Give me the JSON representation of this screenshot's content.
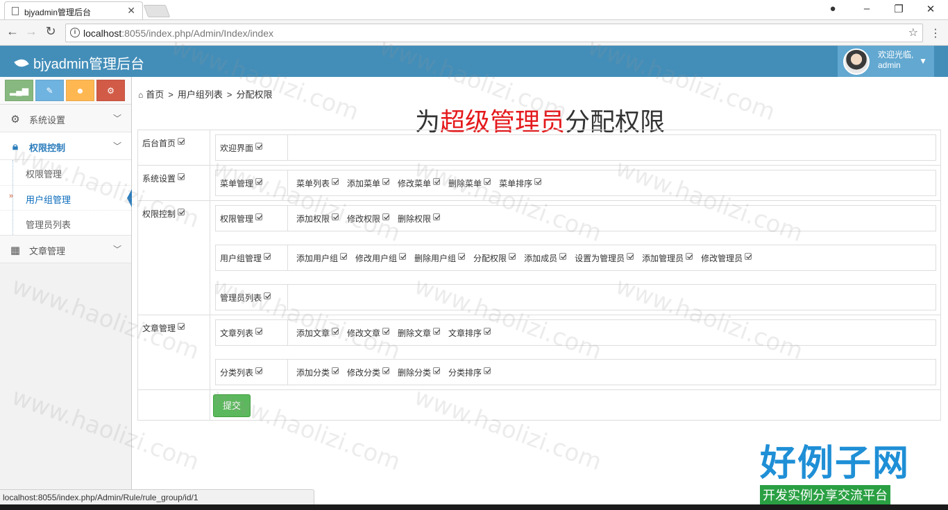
{
  "browser": {
    "tab_title": "bjyadmin管理后台",
    "url_host": "localhost",
    "url_rest": ":8055/index.php/Admin/Index/index",
    "status_url": "localhost:8055/index.php/Admin/Rule/rule_group/id/1"
  },
  "header": {
    "brand": "bjyadmin管理后台",
    "welcome": "欢迎光临,",
    "username": "admin"
  },
  "sidebar": {
    "shortcut_colors": [
      "#87b87f",
      "#6fb3e0",
      "#ffb752",
      "#d15b47"
    ],
    "menus": [
      {
        "label": "系统设置",
        "icon": "gear-icon",
        "open": false
      },
      {
        "label": "权限控制",
        "icon": "lock-icon",
        "open": true,
        "children": [
          "权限管理",
          "用户组管理",
          "管理员列表"
        ],
        "active_child": 1
      },
      {
        "label": "文章管理",
        "icon": "grid-icon",
        "open": false
      }
    ]
  },
  "breadcrumb": [
    "首页",
    "用户组列表",
    "分配权限"
  ],
  "headline": {
    "prefix": "为",
    "highlight": "超级管理员",
    "suffix": "分配权限"
  },
  "groups": [
    {
      "name": "后台首页",
      "modules": [
        {
          "name": "欢迎界面",
          "actions": []
        }
      ]
    },
    {
      "name": "系统设置",
      "modules": [
        {
          "name": "菜单管理",
          "actions": [
            "菜单列表",
            "添加菜单",
            "修改菜单",
            "删除菜单",
            "菜单排序"
          ]
        }
      ]
    },
    {
      "name": "权限控制",
      "modules": [
        {
          "name": "权限管理",
          "actions": [
            "添加权限",
            "修改权限",
            "删除权限"
          ]
        },
        {
          "name": "用户组管理",
          "actions": [
            "添加用户组",
            "修改用户组",
            "删除用户组",
            "分配权限",
            "添加成员",
            "设置为管理员",
            "添加管理员",
            "修改管理员"
          ]
        },
        {
          "name": "管理员列表",
          "actions": []
        }
      ]
    },
    {
      "name": "文章管理",
      "modules": [
        {
          "name": "文章列表",
          "actions": [
            "添加文章",
            "修改文章",
            "删除文章",
            "文章排序"
          ]
        },
        {
          "name": "分类列表",
          "actions": [
            "添加分类",
            "修改分类",
            "删除分类",
            "分类排序"
          ]
        }
      ]
    }
  ],
  "submit_label": "提交",
  "watermark": {
    "title": "好例子网",
    "subtitle": "开发实例分享交流平台",
    "repeat": "www.haolizi.com"
  }
}
